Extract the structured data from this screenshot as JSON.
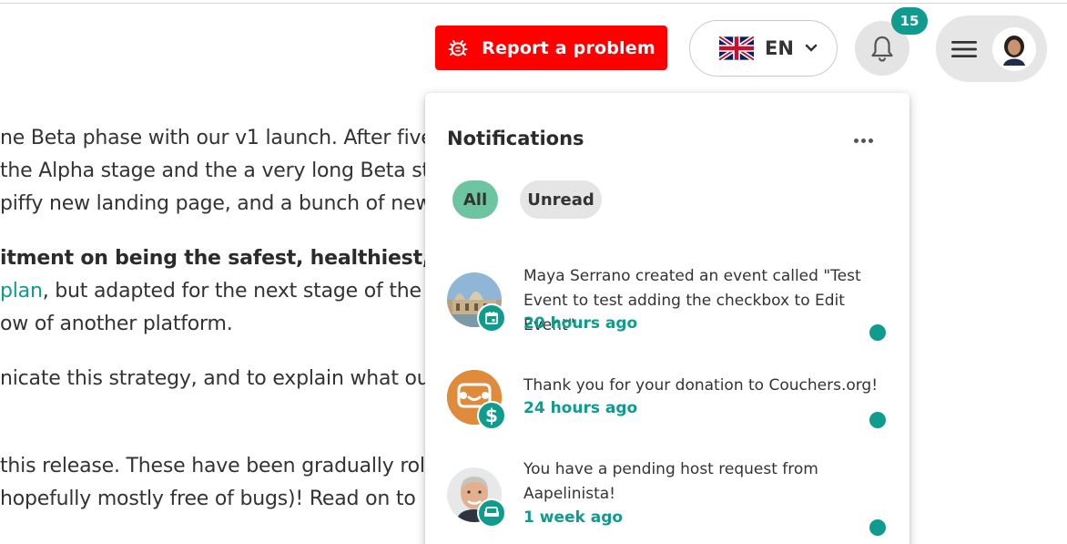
{
  "article": {
    "lines": [
      {
        "text": "ne Beta phase with our v1 launch. After five"
      },
      {
        "text": " the Alpha stage and the a very long Beta st"
      },
      {
        "text": "piffy new landing page, and a bunch of new"
      },
      {
        "text": "itment on being the safest, healthiest, an"
      },
      {
        "link": " plan",
        "text": ", but adapted for the next stage of the"
      },
      {
        "text": "ow of another platform."
      },
      {
        "text": "nicate this strategy, and to explain what our"
      },
      {
        "text": "this release. These have been gradually rolle"
      },
      {
        "text": " hopefully mostly free of bugs)! Read on to"
      }
    ]
  },
  "header": {
    "report_label": "Report a problem",
    "language": "EN",
    "notification_count": "15"
  },
  "notifications": {
    "title": "Notifications",
    "filters": {
      "all": "All",
      "unread": "Unread"
    },
    "items": [
      {
        "text": "Maya Serrano created an event called \"Test Event to test adding the checkbox to Edit Event\"",
        "time": "20 hours ago",
        "type_icon": "calendar-icon"
      },
      {
        "text": "Thank you for your donation to Couchers.org!",
        "time": "24 hours ago",
        "type_icon": "dollar-icon"
      },
      {
        "text": "You have a pending host request from Aapelinista!",
        "time": "1 week ago",
        "type_icon": "couch-icon"
      }
    ]
  },
  "colors": {
    "accent": "#0f9b8e",
    "report": "#ff0000",
    "chip_active": "#6cc4a1"
  }
}
